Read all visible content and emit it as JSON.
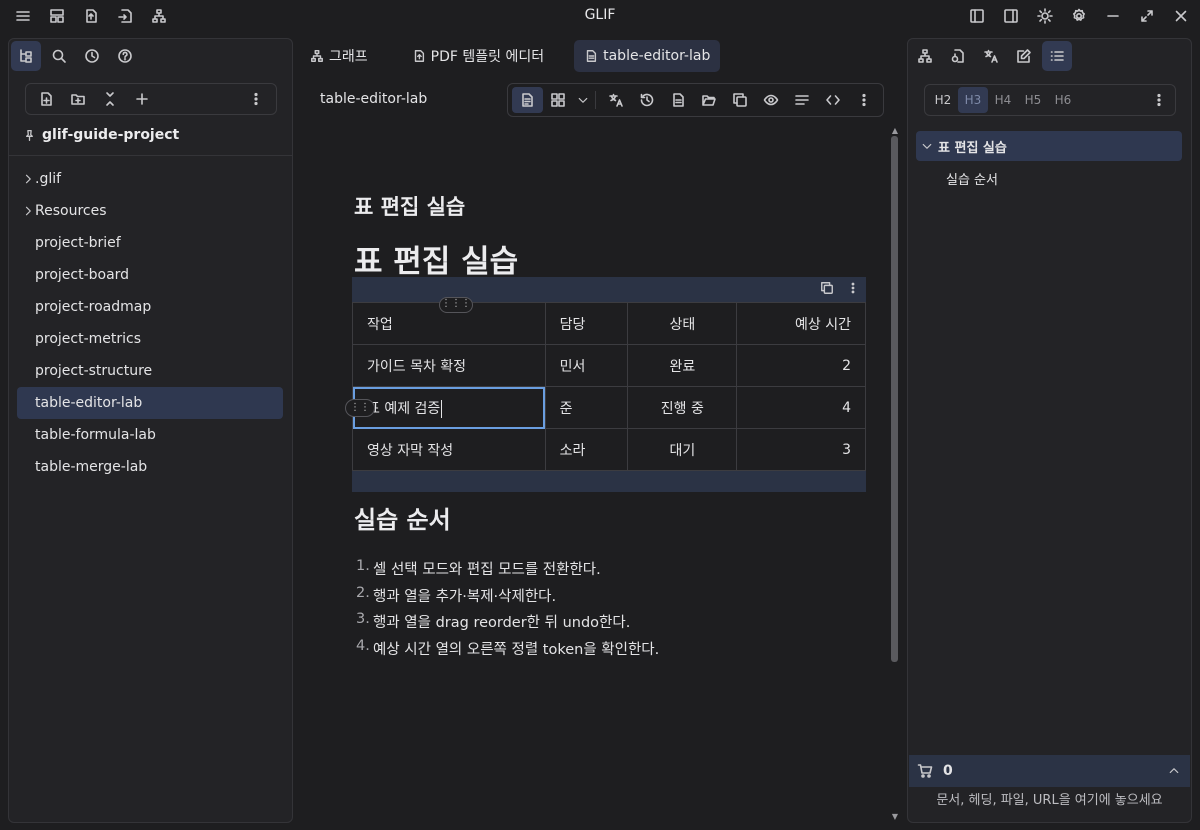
{
  "window": {
    "title": "GLIF"
  },
  "left_panel": {
    "project_name": "glif-guide-project",
    "tree": [
      {
        "label": ".glif",
        "type": "folder"
      },
      {
        "label": "Resources",
        "type": "folder"
      },
      {
        "label": "project-brief",
        "type": "file"
      },
      {
        "label": "project-board",
        "type": "file"
      },
      {
        "label": "project-roadmap",
        "type": "file"
      },
      {
        "label": "project-metrics",
        "type": "file"
      },
      {
        "label": "project-structure",
        "type": "file"
      },
      {
        "label": "table-editor-lab",
        "type": "file",
        "selected": true
      },
      {
        "label": "table-formula-lab",
        "type": "file"
      },
      {
        "label": "table-merge-lab",
        "type": "file"
      }
    ]
  },
  "tabs": [
    {
      "label": "그래프",
      "icon": "graph-icon"
    },
    {
      "label": "PDF 템플릿 에디터",
      "icon": "pdf-file-icon"
    },
    {
      "label": "table-editor-lab",
      "icon": "document-icon",
      "active": true
    }
  ],
  "editor": {
    "doc_name": "table-editor-lab",
    "heading3": "표 편집 실습",
    "heading1": "표 편집 실습",
    "table": {
      "headers": [
        "작업",
        "담당",
        "상태",
        "예상 시간"
      ],
      "rows": [
        [
          "가이드 목차 확정",
          "민서",
          "완료",
          "2"
        ],
        [
          "표 예제 검증",
          "준",
          "진행 중",
          "4"
        ],
        [
          "영상 자막 작성",
          "소라",
          "대기",
          "3"
        ]
      ]
    },
    "heading2": "실습 순서",
    "steps": [
      "셀 선택 모드와 편집 모드를 전환한다.",
      "행과 열을 추가·복제·삭제한다.",
      "행과 열을 drag reorder한 뒤 undo한다.",
      "예상 시간 열의 오른쪽 정렬 token을 확인한다."
    ]
  },
  "right_panel": {
    "heading_levels": [
      "H2",
      "H3",
      "H4",
      "H5",
      "H6"
    ],
    "outline": [
      {
        "label": "표 편집 실습",
        "level": 1
      },
      {
        "label": "실습 순서",
        "level": 2
      }
    ],
    "cart_count": "0",
    "drop_hint": "문서, 헤딩, 파일, URL을 여기에 놓으세요"
  },
  "colors": {
    "accent": "#6a9ee0",
    "selection": "#2f3850",
    "table_bar": "#2b3345"
  }
}
